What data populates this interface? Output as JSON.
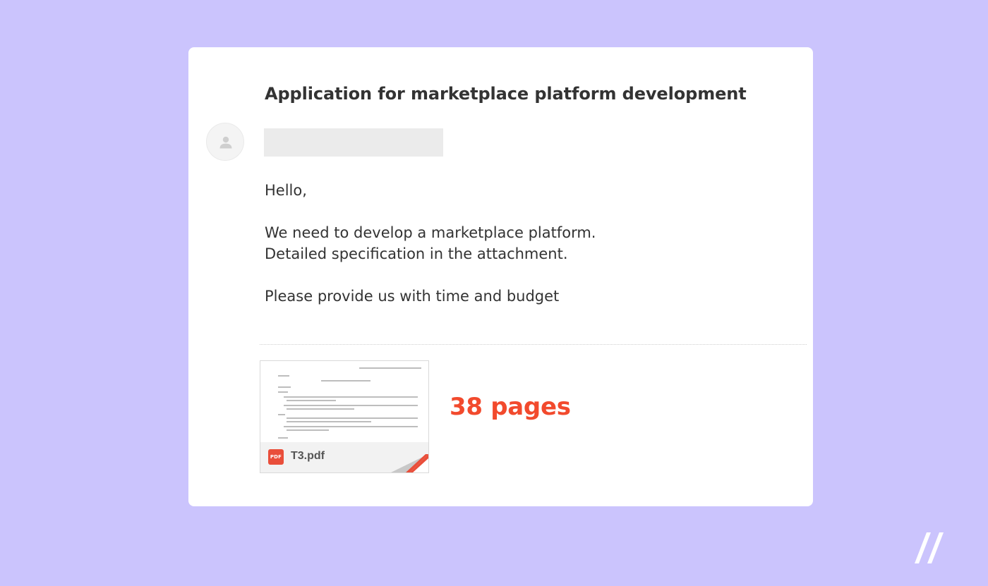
{
  "email": {
    "subject": "Application for marketplace platform development",
    "avatar_icon": "person-icon",
    "body": {
      "greeting": "Hello,",
      "line1": "We need to develop a marketplace platform.",
      "line2": "Detailed specification in the attachment.",
      "line3": "Please provide us with time and budget"
    },
    "attachment": {
      "file_type_badge": "PDF",
      "file_name": "T3.pdf",
      "icon": "pdf-file-icon"
    },
    "page_count": "38 pages"
  },
  "brand": {
    "logo_icon": "double-slash-logo-icon"
  },
  "colors": {
    "background": "#cbc4fd",
    "card": "#ffffff",
    "text": "#333333",
    "accent": "#f24a2d",
    "redacted": "#ebebeb"
  }
}
